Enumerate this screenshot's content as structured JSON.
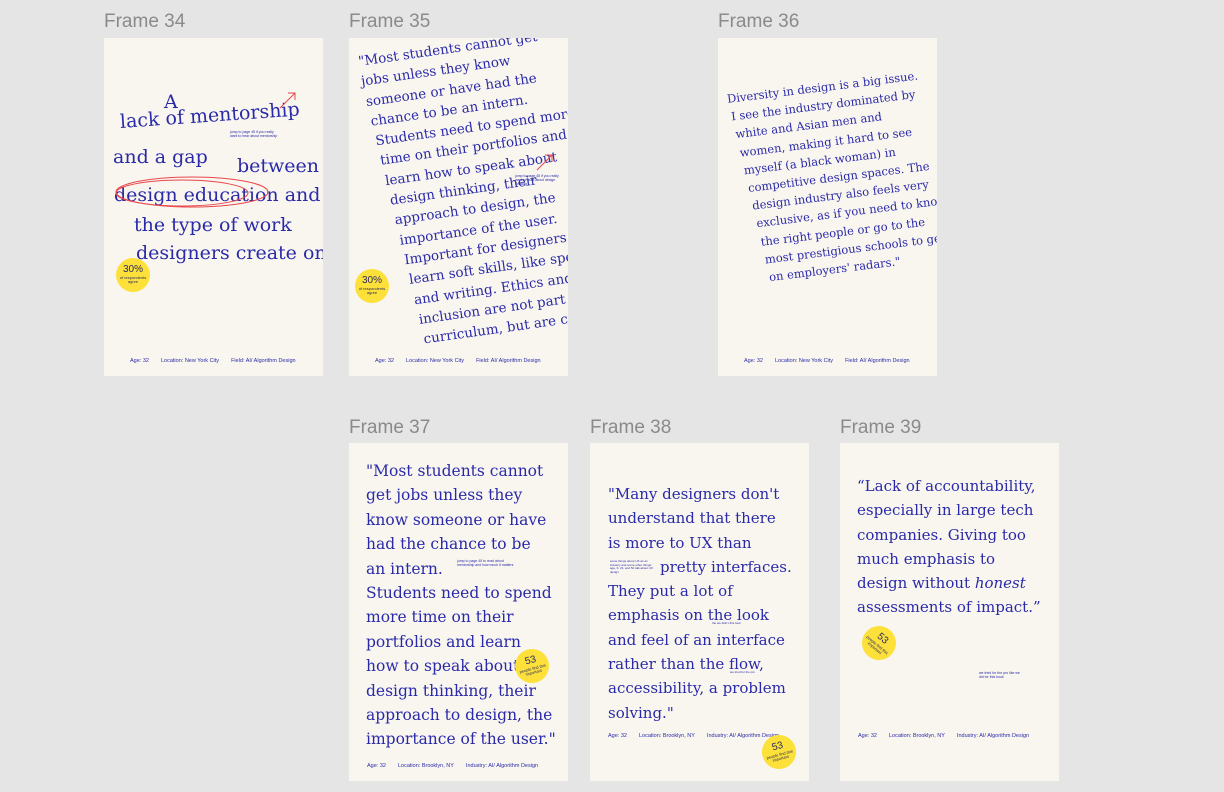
{
  "frames": [
    {
      "label": "Frame 34",
      "lines": [
        "A",
        "lack of mentorship",
        "and a gap",
        "between",
        "design education and",
        "the type of work",
        "designers create on"
      ],
      "note": "jump to page 45 if you really want to hear about mentorship",
      "badge": {
        "value": "30%",
        "caption": "of respondents agree"
      },
      "footer": [
        "Age: 32",
        "Location: New York City",
        "Field: AI/ Algorithm Design"
      ]
    },
    {
      "label": "Frame 35",
      "lines": [
        "\"Most students cannot get",
        "jobs unless they know",
        "someone or have had the",
        "chance to be an intern.",
        "Students need to spend more",
        "time on their portfolios and",
        "learn how to speak about",
        "design thinking, their",
        "approach to design, the",
        "importance of the user.",
        "Important for designers to",
        "learn soft skills, like speaking",
        "and writing. Ethics and",
        "inclusion are not part of",
        "curriculum, but are critical.\""
      ],
      "note": "jump to page 45 if you really want to read about design thinking",
      "badge": {
        "value": "30%",
        "caption": "of respondents agree"
      },
      "footer": [
        "Age: 32",
        "Location: New York City",
        "Field: AI/ Algorithm Design"
      ]
    },
    {
      "label": "Frame 36",
      "lines": [
        "Diversity in design is a big issue.",
        "I see the industry dominated by",
        "white and Asian men and",
        "women, making it hard to see",
        "myself (a black woman) in",
        "competitive design spaces. The",
        "design industry also feels very",
        "exclusive, as if you need to know",
        "the right people or go to the",
        "most prestigious schools to get",
        "on employers' radars.\""
      ],
      "footer": [
        "Age: 32",
        "Location: New York City",
        "Field: AI/ Algorithm Design"
      ]
    },
    {
      "label": "Frame 37",
      "lines": [
        "\"Most students cannot",
        "get jobs unless they",
        "know someone or have",
        "had the chance to be",
        "an intern.",
        "Students need to spend",
        "more time on their",
        "portfolios and learn",
        "how to speak about",
        "design thinking, their",
        "approach to design, the",
        "importance of the user.\""
      ],
      "note": "jump to page 45 to read about mentorship and how much it matters",
      "badge": {
        "value": "53",
        "caption": "people find this important"
      },
      "footer": [
        "Age: 32",
        "Location: Brooklyn, NY",
        "Industry: AI/ Algorithm Design"
      ]
    },
    {
      "label": "Frame 38",
      "lines": [
        "\"Many designers don't",
        "understand that there",
        "is more to UX than",
        "pretty interfaces.",
        "They put a lot of",
        "emphasis on the look",
        "and feel of an interface",
        "rather than the flow,",
        "accessibility, a problem",
        "solving.\""
      ],
      "note": "some things about UX as an industry and some other things: age, 6, 23, and 52 talk about UX design",
      "note2": "the we didn't this look",
      "note3": "we tried for the pro",
      "badge": {
        "value": "53",
        "caption": "people find this important"
      },
      "footer": [
        "Age: 32",
        "Location: Brooklyn, NY",
        "Industry: AI/ Algorithm Design"
      ]
    },
    {
      "label": "Frame 39",
      "lines": [
        "“Lack of accountability,",
        "especially in large tech",
        "companies. Giving too",
        "much emphasis to",
        "design without ",
        "honest",
        "assessments of impact.”"
      ],
      "note": "we tried for the pro like we did for this book",
      "badge": {
        "value": "53",
        "caption": "people find this important"
      },
      "footer": [
        "Age: 32",
        "Location: Brooklyn, NY",
        "Industry: AI/ Algorithm Design"
      ]
    }
  ],
  "colors": {
    "text": "#2a2aa8",
    "accent": "#fde13a",
    "annotation": "#e8474a"
  }
}
